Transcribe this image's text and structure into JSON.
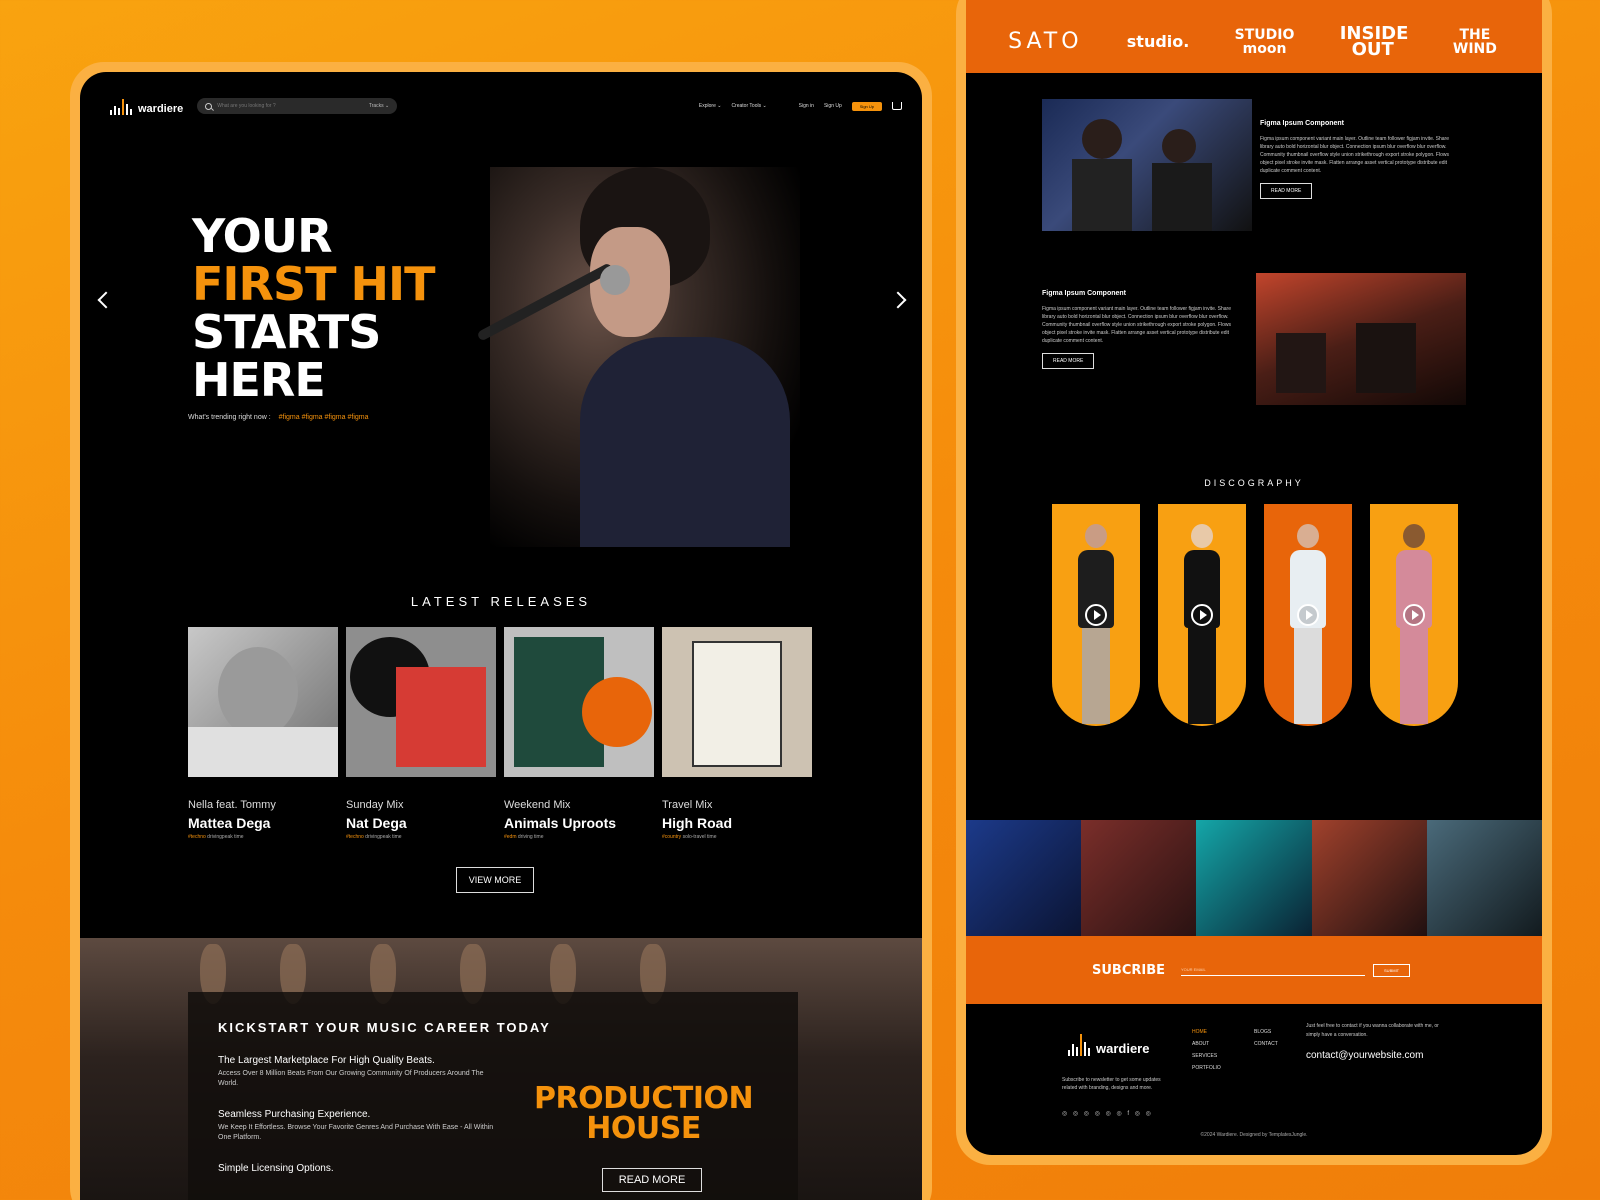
{
  "colors": {
    "background": "#f7920d",
    "accent": "#f5920c",
    "brand_orange": "#e8650a",
    "frame": "#fbb042"
  },
  "nav": {
    "logo": "wardiere",
    "search_placeholder": "What are you looking for ?",
    "search_category": "Tracks ⌄",
    "explore": "Explore ⌄",
    "creator_tools": "Creator Tools ⌄",
    "sign_in": "Sign in",
    "sign_up": "Sign Up",
    "signup_button": "Sign Up",
    "cart_icon": "cart-icon"
  },
  "hero": {
    "line1": "YOUR",
    "line2": "FIRST HIT",
    "line3": "STARTS",
    "line4": "HERE",
    "trending_label": "What's trending right now :",
    "tags": "#figma  #figma  #figma  #figma"
  },
  "releases": {
    "title": "LATEST RELEASES",
    "items": [
      {
        "sub": "Nella feat. Tommy",
        "title": "Mattea Dega",
        "tag": "#techno",
        "meta": " drivingpeak time"
      },
      {
        "sub": "Sunday Mix",
        "title": "Nat Dega",
        "tag": "#techno",
        "meta": " drivingpeak time"
      },
      {
        "sub": "Weekend Mix",
        "title": "Animals Uproots",
        "tag": "#edm",
        "meta": " driving time"
      },
      {
        "sub": "Travel Mix",
        "title": "High Road",
        "tag": "#country",
        "meta": " solo-travel time"
      }
    ],
    "view_more": "VIEW MORE"
  },
  "studio": {
    "title": "KICKSTART YOUR MUSIC CAREER TODAY",
    "features": [
      {
        "title": "The Largest Marketplace For High Quality Beats.",
        "desc": "Access Over 8 Million Beats From Our Growing Community Of Producers Around The World."
      },
      {
        "title": "Seamless Purchasing Experience.",
        "desc": "We Keep It Effortless. Browse Your Favorite Genres And Purchase With Ease - All Within One Platform."
      },
      {
        "title": "Simple Licensing Options.",
        "desc": ""
      }
    ],
    "production_line1": "PRODUCTION",
    "production_line2": "HOUSE",
    "read_more": "READ MORE"
  },
  "brands": [
    "SATO",
    "studio.",
    "STUDIO moon",
    "INSIDE OUT",
    "THE WIND"
  ],
  "features": [
    {
      "title": "Figma Ipsum Component",
      "desc": "Figma ipsum component variant main layer. Outline team follower figjam invite. Share library auto bold horizontal blur object. Connection ipsum blur overflow blur overflow. Community thumbnail overflow style union strikethrough export stroke polygon. Flows object pixel stroke invite mask. Flatten arrange asset vertical prototype distribute edit duplicate comment content.",
      "read_more": "READ MORE"
    },
    {
      "title": "Figma Ipsum Component",
      "desc": "Figma ipsum component variant main layer. Outline team follower figjam invite. Share library auto bold horizontal blur object. Connection ipsum blur overflow blur overflow. Community thumbnail overflow style union strikethrough export stroke polygon. Flows object pixel stroke invite mask. Flatten arrange asset vertical prototype distribute edit duplicate comment content.",
      "read_more": "READ MORE"
    }
  ],
  "discography": {
    "title": "DISCOGRAPHY"
  },
  "subscribe": {
    "title": "SUBCRIBE",
    "placeholder": "YOUR EMAIL",
    "button": "SUBMIT"
  },
  "footer": {
    "logo": "wardiere",
    "desc": "Subscribe to newsletter to get some updates related with branding, designs and more.",
    "social": "◎ ◎ ◎ ◎ ◎ ◎ f ◎ ◎",
    "links_col1": [
      "HOME",
      "ABOUT",
      "SERVICES",
      "PORTFOLIO"
    ],
    "links_col2": [
      "BLOGS",
      "CONTACT"
    ],
    "contact_desc": "Just feel free to contact if you wanna collaborate with me, or simply have a conversation.",
    "email": "contact@yourwebsite.com",
    "copyright": "©2024 Wardiere. Designed by TemplatesJungle."
  }
}
